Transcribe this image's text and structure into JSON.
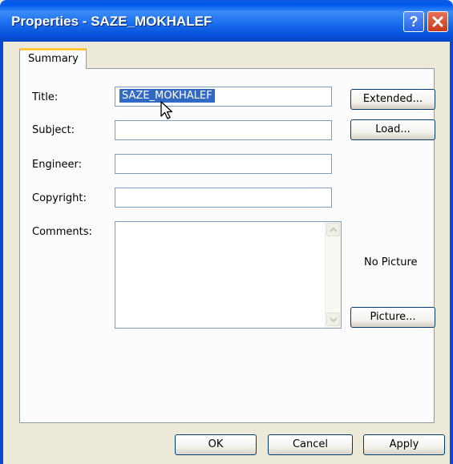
{
  "window": {
    "title": "Properties - SAZE_MOKHALEF"
  },
  "titlebar": {
    "help_glyph": "?",
    "close_icon": "close-icon"
  },
  "tabs": [
    {
      "label": "Summary",
      "active": true
    }
  ],
  "form": {
    "title_label": "Title:",
    "title_value": "SAZE_MOKHALEF",
    "subject_label": "Subject:",
    "subject_value": "",
    "engineer_label": "Engineer:",
    "engineer_value": "",
    "copyright_label": "Copyright:",
    "copyright_value": "",
    "comments_label": "Comments:",
    "comments_value": ""
  },
  "side_buttons": {
    "extended": "Extended...",
    "load": "Load...",
    "picture": "Picture..."
  },
  "picture_status": "No Picture",
  "footer": {
    "ok": "OK",
    "cancel": "Cancel",
    "apply": "Apply"
  },
  "colors": {
    "titlebar": "#0058EE",
    "selection": "#316AC5",
    "dialog_bg": "#ECE9D8",
    "tab_accent": "#FFC83C"
  }
}
